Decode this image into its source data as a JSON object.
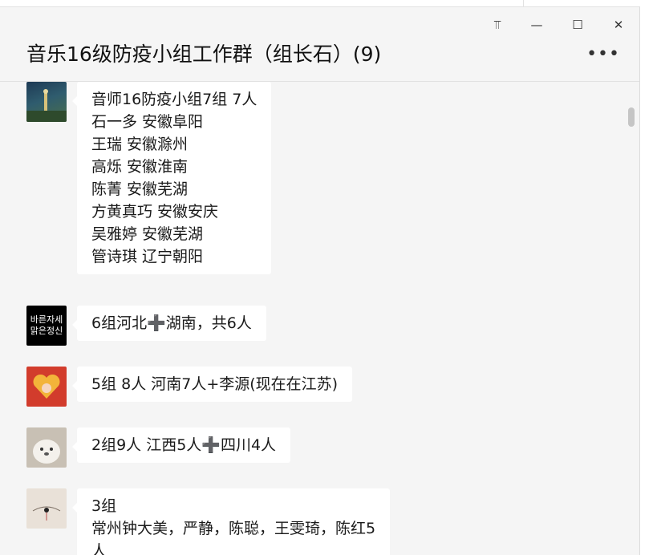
{
  "window": {
    "title": "音乐16级防疫小组工作群（组长石）(9)",
    "controls": {
      "pin": "⫪",
      "minimize": "—",
      "maximize": "☐",
      "close": "✕"
    },
    "more": "•••"
  },
  "messages": [
    {
      "lines": [
        "音师16防疫小组7组  7人",
        "石一多 安徽阜阳",
        "王瑞   安徽滁州",
        "高烁   安徽淮南",
        "陈菁   安徽芜湖",
        "方黄真巧 安徽安庆",
        "吴雅婷 安徽芜湖",
        "管诗琪 辽宁朝阳"
      ]
    },
    {
      "lines": [
        "6组河北➕湖南，共6人"
      ],
      "avatar_text": [
        "바른자세",
        "맑은정신"
      ]
    },
    {
      "lines": [
        "5组 8人   河南7人+李源(现在在江苏)"
      ]
    },
    {
      "lines": [
        "2组9人 江西5人➕四川4人"
      ]
    },
    {
      "lines": [
        "3组",
        "常州钟大美，严静，陈聪，王雯琦，陈红5",
        "人"
      ]
    }
  ],
  "colors": {
    "background": "#f5f5f5",
    "bubble": "#ffffff"
  }
}
